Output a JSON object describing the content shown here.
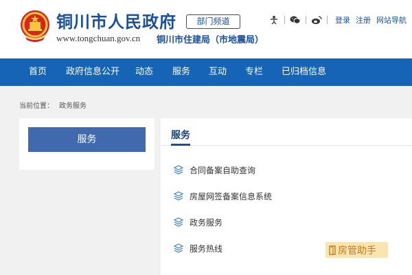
{
  "header": {
    "site_title": "铜川市人民政府",
    "badge": "部门频道",
    "domain": "www.tongchuan.gov.cn",
    "department": "铜川市住建局（市地震局）"
  },
  "top_tools": {
    "login": "登录",
    "register": "注册",
    "site_nav": "网站导航"
  },
  "nav": {
    "items": [
      "首页",
      "政府信息公开",
      "动态",
      "服务",
      "互动",
      "专栏",
      "已归档信息"
    ]
  },
  "breadcrumb": {
    "label": "当前位置：",
    "current": "政务服务"
  },
  "sidebar": {
    "button_label": "服务"
  },
  "main": {
    "title": "服务",
    "items": [
      "合同备案自助查询",
      "房屋网签备案信息系统",
      "政务服务",
      "服务热线"
    ]
  },
  "watermark": {
    "text": "房管助手"
  },
  "colors": {
    "brand_blue": "#1564b5",
    "title_blue": "#1a4f9a",
    "button_blue": "#4169ad"
  }
}
